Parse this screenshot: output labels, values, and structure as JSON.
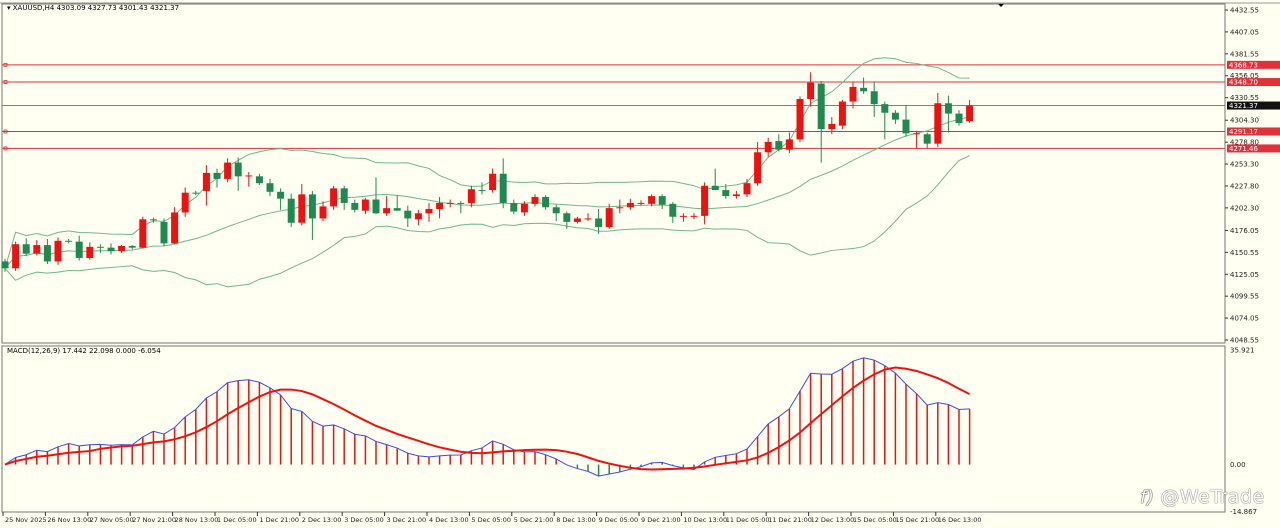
{
  "header": {
    "symbol_info": "XAUUSD,H4  4303.09 4327.73 4301.43 4321.37",
    "macd_info": "MACD(12,26,9) 17.442 22.098 0.000 -6.054"
  },
  "colors": {
    "background": "#fffff2",
    "bull_candle": "#f01010",
    "bear_candle": "#1f8a50",
    "bollinger": "#6db889",
    "level_line": "#e0303a",
    "price_line": "#808080",
    "macd_line": "#3a4ee0",
    "signal_line": "#f01010"
  },
  "price_axis": {
    "range": [
      4048.55,
      4432.55
    ],
    "ticks": [
      "4432.55",
      "4407.05",
      "4381.55",
      "4356.05",
      "4330.55",
      "4304.30",
      "4278.80",
      "4253.30",
      "4227.80",
      "4202.30",
      "4176.05",
      "4150.55",
      "4125.05",
      "4099.55",
      "4074.05",
      "4048.55"
    ],
    "current_price": "4321.37",
    "levels": [
      "4368.73",
      "4348.70",
      "4291.17",
      "4271.46"
    ]
  },
  "macd_axis": {
    "range": [
      -14.867,
      35.921
    ],
    "ticks": [
      "35.921",
      "0.00",
      "-14.867"
    ]
  },
  "time_axis": {
    "label_every_bars": 4,
    "labels": [
      "25 Nov 2025",
      "26 Nov 13:00",
      "27 Nov 05:00",
      "27 Nov 21:00",
      "28 Nov 13:00",
      "1 Dec 05:00",
      "1 Dec 21:00",
      "2 Dec 13:00",
      "3 Dec 05:00",
      "3 Dec 21:00",
      "4 Dec 13:00",
      "5 Dec 05:00",
      "5 Dec 21:00",
      "8 Dec 13:00",
      "9 Dec 05:00",
      "9 Dec 21:00",
      "10 Dec 13:00",
      "11 Dec 05:00",
      "11 Dec 21:00",
      "12 Dec 13:00",
      "15 Dec 05:00",
      "15 Dec 21:00",
      "16 Dec 13:00"
    ]
  },
  "indicators": {
    "bollinger": {
      "period": 20,
      "deviations": 2
    },
    "macd": {
      "fast": 12,
      "slow": 26,
      "signal": 9
    }
  },
  "chart_data": {
    "type": "candlestick",
    "symbol": "XAUUSD",
    "timeframe": "H4",
    "ohlc": [
      [
        4140,
        4143,
        4128,
        4132
      ],
      [
        4132,
        4163,
        4129,
        4160
      ],
      [
        4160,
        4167,
        4146,
        4149
      ],
      [
        4149,
        4165,
        4147,
        4159
      ],
      [
        4159,
        4166,
        4137,
        4140
      ],
      [
        4140,
        4168,
        4136,
        4164
      ],
      [
        4164,
        4166,
        4161,
        4163
      ],
      [
        4163,
        4170,
        4141,
        4144
      ],
      [
        4144,
        4162,
        4142,
        4157
      ],
      [
        4157,
        4160,
        4150,
        4156
      ],
      [
        4156,
        4161,
        4148,
        4152
      ],
      [
        4152,
        4159,
        4150,
        4158
      ],
      [
        4158,
        4159,
        4154,
        4156
      ],
      [
        4156,
        4192,
        4155,
        4189
      ],
      [
        4189,
        4191,
        4185,
        4188
      ],
      [
        4186,
        4190,
        4158,
        4161
      ],
      [
        4161,
        4203,
        4160,
        4197
      ],
      [
        4197,
        4226,
        4192,
        4220
      ],
      [
        4220,
        4222,
        4217,
        4219
      ],
      [
        4222,
        4252,
        4205,
        4243
      ],
      [
        4243,
        4248,
        4226,
        4236
      ],
      [
        4236,
        4260,
        4232,
        4255
      ],
      [
        4255,
        4261,
        4222,
        4239
      ],
      [
        4239,
        4244,
        4227,
        4240
      ],
      [
        4239,
        4242,
        4229,
        4231
      ],
      [
        4231,
        4236,
        4216,
        4221
      ],
      [
        4221,
        4225,
        4200,
        4213
      ],
      [
        4213,
        4219,
        4180,
        4185
      ],
      [
        4185,
        4230,
        4182,
        4218
      ],
      [
        4218,
        4222,
        4165,
        4190
      ],
      [
        4190,
        4210,
        4187,
        4204
      ],
      [
        4204,
        4228,
        4200,
        4225
      ],
      [
        4225,
        4228,
        4200,
        4208
      ],
      [
        4208,
        4212,
        4197,
        4200
      ],
      [
        4199,
        4214,
        4195,
        4212
      ],
      [
        4212,
        4238,
        4195,
        4196
      ],
      [
        4196,
        4216,
        4193,
        4202
      ],
      [
        4202,
        4217,
        4199,
        4199
      ],
      [
        4199,
        4205,
        4180,
        4190
      ],
      [
        4189,
        4200,
        4182,
        4196
      ],
      [
        4196,
        4208,
        4186,
        4201
      ],
      [
        4201,
        4215,
        4190,
        4208
      ],
      [
        4208,
        4212,
        4203,
        4208
      ],
      [
        4208,
        4210,
        4196,
        4207
      ],
      [
        4208,
        4228,
        4203,
        4224
      ],
      [
        4223,
        4232,
        4218,
        4222
      ],
      [
        4223,
        4248,
        4220,
        4242
      ],
      [
        4242,
        4260,
        4202,
        4208
      ],
      [
        4208,
        4212,
        4195,
        4198
      ],
      [
        4197,
        4210,
        4193,
        4207
      ],
      [
        4207,
        4218,
        4204,
        4215
      ],
      [
        4215,
        4217,
        4200,
        4203
      ],
      [
        4203,
        4206,
        4187,
        4196
      ],
      [
        4196,
        4198,
        4178,
        4186
      ],
      [
        4186,
        4192,
        4184,
        4190
      ],
      [
        4190,
        4196,
        4187,
        4190
      ],
      [
        4190,
        4201,
        4172,
        4180
      ],
      [
        4180,
        4207,
        4178,
        4202
      ],
      [
        4203,
        4212,
        4196,
        4203
      ],
      [
        4203,
        4213,
        4200,
        4208
      ],
      [
        4208,
        4211,
        4205,
        4208
      ],
      [
        4207,
        4218,
        4204,
        4216
      ],
      [
        4216,
        4218,
        4201,
        4206
      ],
      [
        4207,
        4209,
        4185,
        4192
      ],
      [
        4192,
        4196,
        4186,
        4193
      ],
      [
        4192,
        4196,
        4189,
        4193
      ],
      [
        4193,
        4232,
        4183,
        4228
      ],
      [
        4228,
        4248,
        4224,
        4223
      ],
      [
        4223,
        4230,
        4213,
        4216
      ],
      [
        4216,
        4222,
        4213,
        4218
      ],
      [
        4218,
        4236,
        4215,
        4231
      ],
      [
        4231,
        4279,
        4228,
        4267
      ],
      [
        4267,
        4284,
        4262,
        4279
      ],
      [
        4280,
        4288,
        4268,
        4270
      ],
      [
        4270,
        4290,
        4266,
        4282
      ],
      [
        4282,
        4332,
        4279,
        4329
      ],
      [
        4329,
        4360,
        4320,
        4348
      ],
      [
        4347,
        4350,
        4255,
        4294
      ],
      [
        4294,
        4308,
        4288,
        4300
      ],
      [
        4298,
        4328,
        4294,
        4326
      ],
      [
        4326,
        4349,
        4318,
        4343
      ],
      [
        4342,
        4354,
        4335,
        4338
      ],
      [
        4338,
        4349,
        4308,
        4323
      ],
      [
        4323,
        4326,
        4282,
        4313
      ],
      [
        4313,
        4316,
        4300,
        4305
      ],
      [
        4305,
        4322,
        4285,
        4289
      ],
      [
        4289,
        4292,
        4272,
        4289
      ],
      [
        4288,
        4290,
        4272,
        4277
      ],
      [
        4277,
        4336,
        4273,
        4324
      ],
      [
        4324,
        4333,
        4290,
        4312
      ],
      [
        4312,
        4316,
        4298,
        4301
      ],
      [
        4303.09,
        4327.73,
        4301.43,
        4321.37
      ]
    ]
  },
  "watermark": "@WeTrade"
}
